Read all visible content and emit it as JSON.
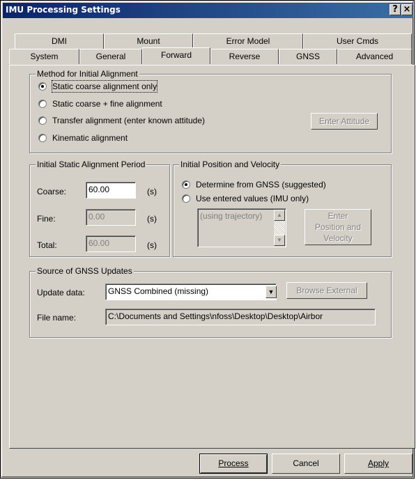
{
  "window": {
    "title": "IMU Processing Settings",
    "help_glyph": "?",
    "close_glyph": "×"
  },
  "tabs_row1": [
    "DMI",
    "Mount",
    "Error Model",
    "User Cmds"
  ],
  "tabs_row2": [
    "System",
    "General",
    "Forward",
    "Reverse",
    "GNSS",
    "Advanced"
  ],
  "selected_tab": "Forward",
  "alignment": {
    "title": "Method for Initial Alignment",
    "options": [
      "Static coarse alignment only",
      "Static coarse + fine alignment",
      "Transfer alignment (enter known attitude)",
      "Kinematic alignment"
    ],
    "selected_index": 0,
    "enter_attitude_label": "Enter Attitude"
  },
  "static_period": {
    "title": "Initial Static Alignment Period",
    "coarse_label": "Coarse:",
    "coarse_value": "60.00",
    "fine_label": "Fine:",
    "fine_value": "0.00",
    "total_label": "Total:",
    "total_value": "60.00",
    "unit": "(s)"
  },
  "position_velocity": {
    "title": "Initial Position and Velocity",
    "options": [
      "Determine from GNSS (suggested)",
      "Use entered values (IMU only)"
    ],
    "selected_index": 0,
    "list_item": "(using trajectory)",
    "enter_button_line1": "Enter",
    "enter_button_line2": "Position and",
    "enter_button_line3": "Velocity"
  },
  "gnss_updates": {
    "title": "Source of GNSS Updates",
    "update_label": "Update data:",
    "update_value": "GNSS Combined (missing)",
    "browse_label": "Browse External",
    "file_label": "File name:",
    "file_value": "C:\\Documents and Settings\\nfoss\\Desktop\\Desktop\\Airbor"
  },
  "buttons": {
    "process": "Process",
    "cancel": "Cancel",
    "apply": "Apply"
  },
  "colors": {
    "title_start": "#0a246a",
    "title_end": "#3a6ea5",
    "face": "#d4d0c8"
  }
}
